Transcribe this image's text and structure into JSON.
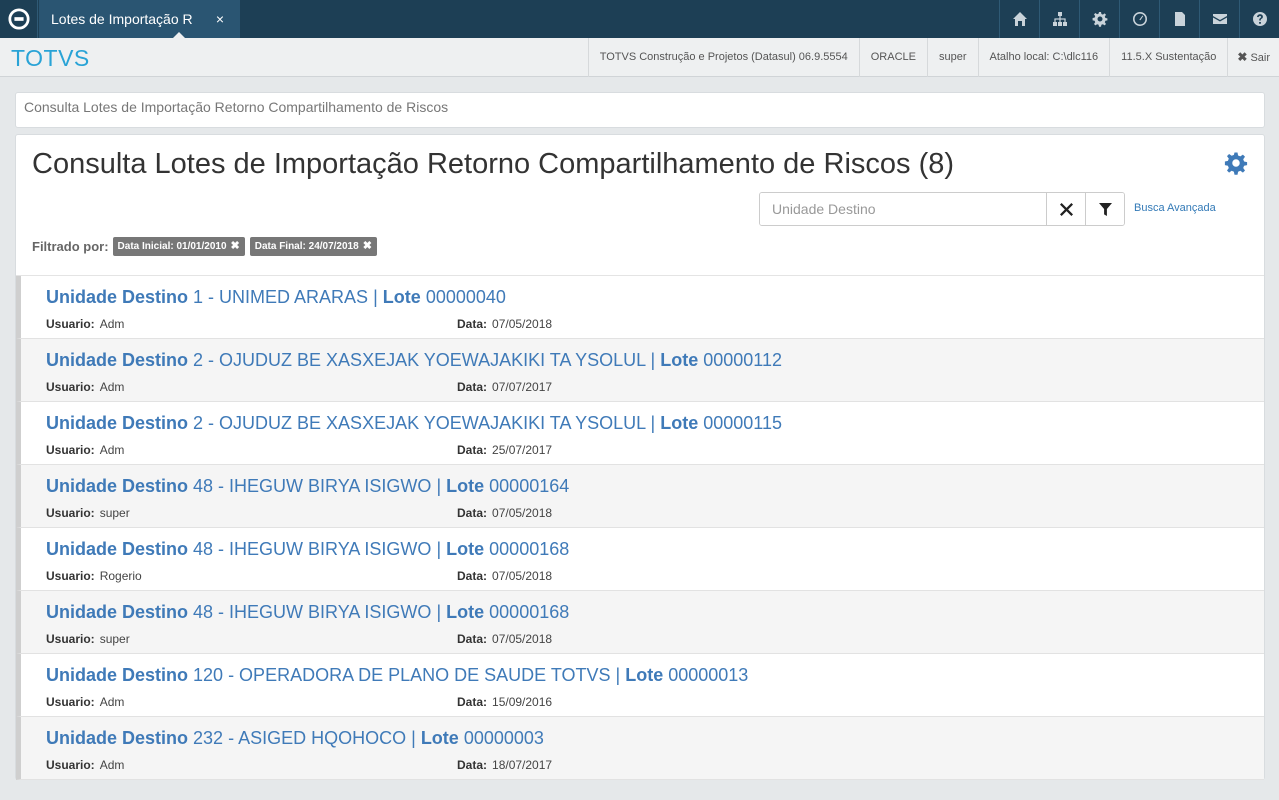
{
  "tab": {
    "label": "Lotes de Importação R",
    "close": "×"
  },
  "top_icons": [
    "home-icon",
    "sitemap-icon",
    "gear-icon",
    "clock-icon",
    "document-icon",
    "mail-icon",
    "help-icon"
  ],
  "brand": "TOTVS",
  "info": {
    "product": "TOTVS Construção e Projetos (Datasul) 06.9.5554",
    "database": "ORACLE",
    "user": "super",
    "shortcut": "Atalho local: C:\\dlc116",
    "version": "11.5.X Sustentação",
    "exit_icon": "✖",
    "exit": "Sair"
  },
  "breadcrumb": "Consulta Lotes de Importação Retorno Compartilhamento de Riscos",
  "page": {
    "title": "Consulta Lotes de Importação Retorno Compartilhamento de Riscos (8)",
    "search_placeholder": "Unidade Destino",
    "advanced_search": "Busca Avançada",
    "filter_label": "Filtrado por:",
    "filters": [
      "Data Inicial: 01/01/2010",
      "Data Final: 24/07/2018"
    ],
    "filter_remove": "✖"
  },
  "labels": {
    "unidade": "Unidade Destino",
    "lote": "Lote",
    "sep": "|",
    "usuario": "Usuario:",
    "data": "Data:"
  },
  "items": [
    {
      "unit": "1 - UNIMED ARARAS",
      "lote": "00000040",
      "user": "Adm",
      "date": "07/05/2018"
    },
    {
      "unit": "2 - OJUDUZ BE XASXEJAK YOEWAJAKIKI TA YSOLUL",
      "lote": "00000112",
      "user": "Adm",
      "date": "07/07/2017"
    },
    {
      "unit": "2 - OJUDUZ BE XASXEJAK YOEWAJAKIKI TA YSOLUL",
      "lote": "00000115",
      "user": "Adm",
      "date": "25/07/2017"
    },
    {
      "unit": "48 - IHEGUW BIRYA ISIGWO",
      "lote": "00000164",
      "user": "super",
      "date": "07/05/2018"
    },
    {
      "unit": "48 - IHEGUW BIRYA ISIGWO",
      "lote": "00000168",
      "user": "Rogerio",
      "date": "07/05/2018"
    },
    {
      "unit": "48 - IHEGUW BIRYA ISIGWO",
      "lote": "00000168",
      "user": "super",
      "date": "07/05/2018"
    },
    {
      "unit": "120 - OPERADORA DE PLANO DE SAUDE TOTVS",
      "lote": "00000013",
      "user": "Adm",
      "date": "15/09/2016"
    },
    {
      "unit": "232 - ASIGED HQOHOCO",
      "lote": "00000003",
      "user": "Adm",
      "date": "18/07/2017"
    }
  ]
}
